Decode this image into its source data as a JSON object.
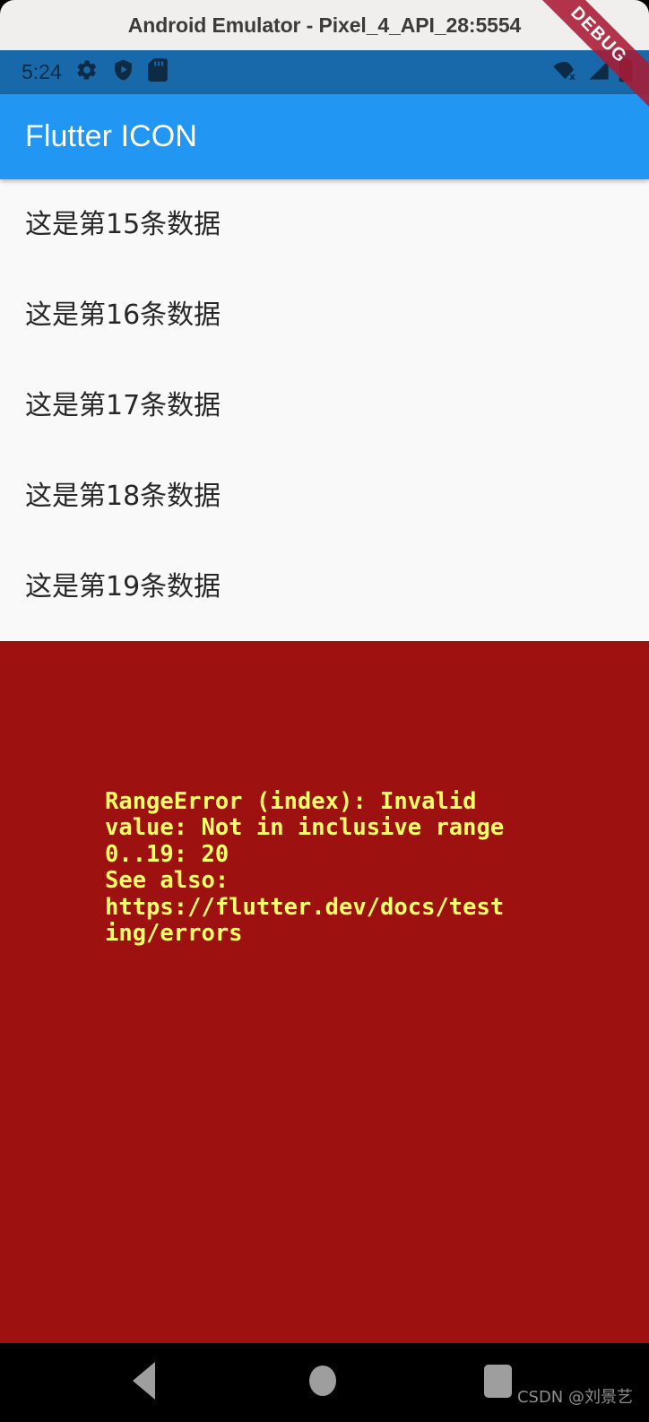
{
  "emulator": {
    "window_title": "Android Emulator - Pixel_4_API_28:5554"
  },
  "status_bar": {
    "clock": "5:24",
    "background_color": "#1769aa",
    "left_icons": [
      {
        "name": "settings-gear-icon"
      },
      {
        "name": "play-protect-shield-icon"
      },
      {
        "name": "sd-card-icon"
      }
    ],
    "right_icons": [
      {
        "name": "wifi-off-icon"
      },
      {
        "name": "cellular-signal-icon"
      },
      {
        "name": "battery-full-icon"
      }
    ]
  },
  "app_bar": {
    "title": "Flutter ICON",
    "background_color": "#2196f3",
    "text_color": "#ffffff"
  },
  "debug_banner": {
    "label": "DEBUG",
    "color": "#a91b35"
  },
  "list": {
    "background_color": "#f9f9f9",
    "items": [
      {
        "label": "这是第15条数据"
      },
      {
        "label": "这是第16条数据"
      },
      {
        "label": "这是第17条数据"
      },
      {
        "label": "这是第18条数据"
      },
      {
        "label": "这是第19条数据"
      }
    ]
  },
  "error_box": {
    "background_color": "#9d1111",
    "text_color": "#ffff66",
    "message": "RangeError (index): Invalid value: Not in inclusive range 0..19: 20\nSee also: https://flutter.dev/docs/testing/errors"
  },
  "nav_bar": {
    "background_color": "#000000",
    "buttons": [
      {
        "name": "back-button"
      },
      {
        "name": "home-button"
      },
      {
        "name": "recents-button"
      }
    ]
  },
  "watermark": {
    "text": "CSDN @刘景艺"
  }
}
